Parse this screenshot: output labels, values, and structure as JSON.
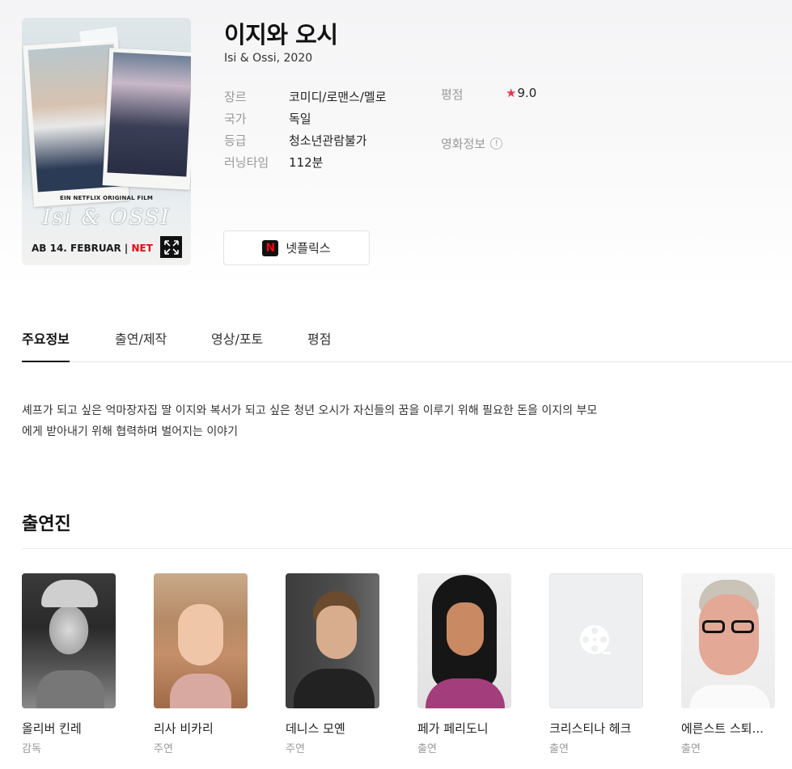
{
  "movie": {
    "title": "이지와 오시",
    "original": "Isi & Ossi, 2020"
  },
  "poster": {
    "tagline": "EIN NETFLIX ORIGINAL FILM",
    "script_title": "Isi & OSSI",
    "date": "AB 14. FEBRUAR",
    "sep": " | ",
    "brand": "NET",
    "expand_icon": "expand-icon"
  },
  "meta": {
    "genre_label": "장르",
    "genre": "코미디/로맨스/멜로",
    "country_label": "국가",
    "country": "독일",
    "grade_label": "등급",
    "grade": "청소년관람불가",
    "runtime_label": "러닝타임",
    "runtime": "112분"
  },
  "rating": {
    "label": "평점",
    "star": "★",
    "value": "9.0",
    "star_color": "#f0334b"
  },
  "info": {
    "label": "영화정보",
    "icon": "!"
  },
  "ott": {
    "logo": "N",
    "label": "넷플릭스"
  },
  "tabs": [
    {
      "label": "주요정보"
    },
    {
      "label": "출연/제작"
    },
    {
      "label": "영상/포토"
    },
    {
      "label": "평점"
    }
  ],
  "synopsis": {
    "line1": "셰프가 되고 싶은 억마장자집 딸 이지와 복서가 되고 싶은 청년 오시가 자신들의 꿈을 이루기 위해 필요한 돈을 이지의 부모",
    "line2": "에게 받아내기 위해 협력하며 벌어지는 이야기"
  },
  "cast": {
    "title": "출연진",
    "people": [
      {
        "name": "올리버 킨레",
        "role": "감독"
      },
      {
        "name": "리사 비카리",
        "role": "주연"
      },
      {
        "name": "데니스 모옌",
        "role": "주연"
      },
      {
        "name": "페가 페리도니",
        "role": "출연"
      },
      {
        "name": "크리스티나 헤크",
        "role": "출연"
      },
      {
        "name": "에른스트 스퇴...",
        "role": "출연"
      }
    ]
  }
}
